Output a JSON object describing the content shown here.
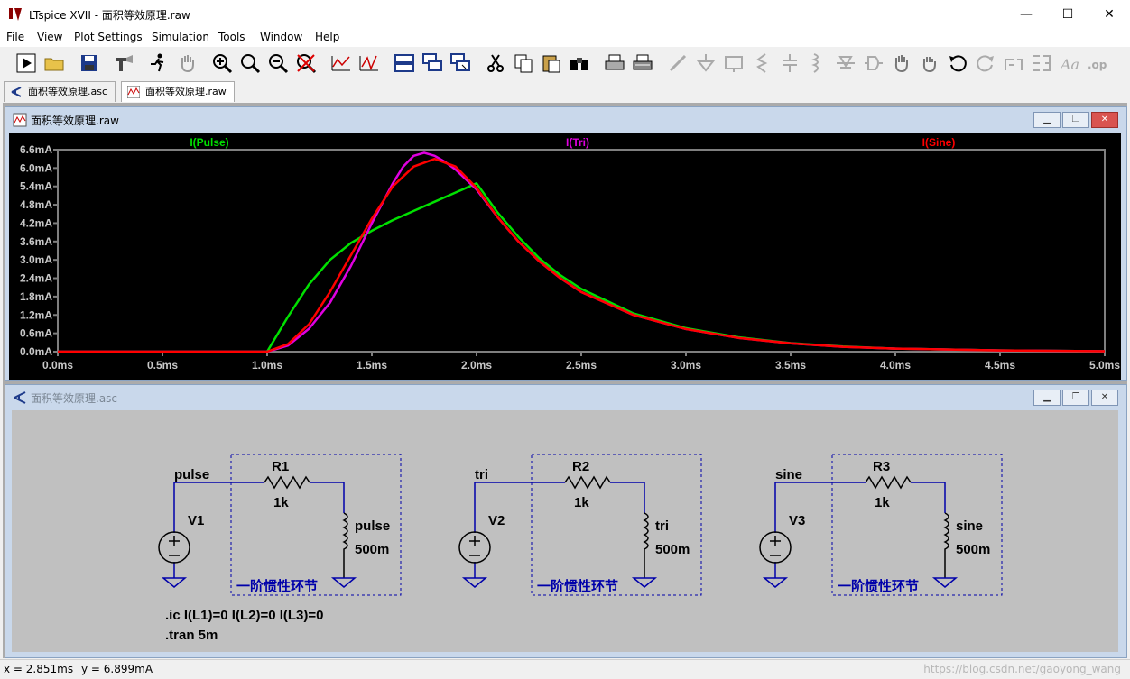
{
  "app": {
    "title": "LTspice XVII - 面积等效原理.raw",
    "controls": {
      "minimize": "—",
      "maximize": "☐",
      "close": "✕"
    }
  },
  "menu": [
    "File",
    "View",
    "Plot Settings",
    "Simulation",
    "Tools",
    "Window",
    "Help"
  ],
  "toolbar_icons": [
    "run-icon",
    "open-icon",
    "save-icon",
    "control-panel-icon",
    "halt-icon",
    "pan-hand-icon",
    "zoom-in-icon",
    "zoom-full-icon",
    "zoom-out-icon",
    "zoom-cancel-icon",
    "autorange-icon",
    "mark-unref-icon",
    "tile-horizontal-icon",
    "tile-cascade-icon",
    "tile-close-icon",
    "cut-icon",
    "copy-icon",
    "paste-icon",
    "find-icon",
    "print-icon",
    "print-setup-icon",
    "wire-icon",
    "ground-icon",
    "label-icon",
    "resistor-icon",
    "capacitor-icon",
    "inductor-icon",
    "diode-icon",
    "component-icon",
    "move-icon",
    "drag-icon",
    "undo-icon",
    "redo-icon",
    "rotate-icon",
    "mirror-icon",
    "text-icon",
    "spice-directive-icon"
  ],
  "tabs": [
    {
      "label": "面积等效原理.asc",
      "icon": "schematic-icon",
      "active": false
    },
    {
      "label": "面积等效原理.raw",
      "icon": "waveform-icon",
      "active": true
    }
  ],
  "plot_window": {
    "title": "面积等效原理.raw"
  },
  "schematic_window": {
    "title": "面积等效原理.asc"
  },
  "colors": {
    "pulse": "#00e000",
    "tri": "#e000e0",
    "sine": "#ff0000",
    "wire": "#0000aa",
    "grid": "#7f7f7f"
  },
  "chart_data": {
    "type": "line",
    "title": "",
    "xlabel": "",
    "ylabel": "",
    "x_ticks": [
      "0.0ms",
      "0.5ms",
      "1.0ms",
      "1.5ms",
      "2.0ms",
      "2.5ms",
      "3.0ms",
      "3.5ms",
      "4.0ms",
      "4.5ms",
      "5.0ms"
    ],
    "y_ticks": [
      "0.0mA",
      "0.6mA",
      "1.2mA",
      "1.8mA",
      "2.4mA",
      "3.0mA",
      "3.6mA",
      "4.2mA",
      "4.8mA",
      "5.4mA",
      "6.0mA",
      "6.6mA"
    ],
    "xlim": [
      0,
      5.0
    ],
    "ylim": [
      0,
      6.6
    ],
    "legend_placement": "top",
    "series": [
      {
        "name": "I(Pulse)",
        "color": "#00e000",
        "x": [
          0,
          0.5,
          1.0,
          1.1,
          1.2,
          1.3,
          1.4,
          1.5,
          1.6,
          1.7,
          1.8,
          1.9,
          2.0,
          2.1,
          2.2,
          2.3,
          2.4,
          2.5,
          2.75,
          3.0,
          3.25,
          3.5,
          3.75,
          4.0,
          4.5,
          5.0
        ],
        "y": [
          0,
          0,
          0,
          1.15,
          2.2,
          3.0,
          3.55,
          3.95,
          4.3,
          4.6,
          4.9,
          5.2,
          5.5,
          4.55,
          3.75,
          3.05,
          2.5,
          2.05,
          1.25,
          0.77,
          0.47,
          0.28,
          0.17,
          0.1,
          0.04,
          0.015
        ]
      },
      {
        "name": "I(Tri)",
        "color": "#e000e0",
        "x": [
          0,
          0.5,
          1.0,
          1.1,
          1.2,
          1.3,
          1.4,
          1.5,
          1.6,
          1.65,
          1.7,
          1.75,
          1.8,
          1.85,
          1.9,
          2.0,
          2.1,
          2.2,
          2.3,
          2.4,
          2.5,
          2.75,
          3.0,
          3.25,
          3.5,
          3.75,
          4.0,
          4.5,
          5.0
        ],
        "y": [
          0,
          0,
          0,
          0.2,
          0.75,
          1.6,
          2.8,
          4.2,
          5.5,
          6.05,
          6.4,
          6.5,
          6.4,
          6.2,
          5.95,
          5.3,
          4.4,
          3.6,
          2.95,
          2.4,
          1.95,
          1.2,
          0.74,
          0.45,
          0.27,
          0.16,
          0.1,
          0.04,
          0.015
        ]
      },
      {
        "name": "I(Sine)",
        "color": "#ff0000",
        "x": [
          0,
          0.5,
          1.0,
          1.1,
          1.2,
          1.3,
          1.4,
          1.5,
          1.6,
          1.7,
          1.8,
          1.9,
          2.0,
          2.1,
          2.2,
          2.3,
          2.4,
          2.5,
          2.75,
          3.0,
          3.25,
          3.5,
          3.75,
          4.0,
          4.5,
          5.0
        ],
        "y": [
          0,
          0,
          0,
          0.25,
          0.9,
          1.95,
          3.15,
          4.35,
          5.4,
          6.05,
          6.3,
          6.05,
          5.35,
          4.4,
          3.6,
          2.95,
          2.4,
          1.95,
          1.2,
          0.74,
          0.45,
          0.27,
          0.16,
          0.1,
          0.04,
          0.015
        ]
      }
    ]
  },
  "schematic": {
    "circuits": [
      {
        "net": "pulse",
        "source": "V1",
        "resistor": "R1",
        "r_value": "1k",
        "inductor_net": "pulse",
        "l_value": "500m",
        "box_label": "一阶惯性环节"
      },
      {
        "net": "tri",
        "source": "V2",
        "resistor": "R2",
        "r_value": "1k",
        "inductor_net": "tri",
        "l_value": "500m",
        "box_label": "一阶惯性环节"
      },
      {
        "net": "sine",
        "source": "V3",
        "resistor": "R3",
        "r_value": "1k",
        "inductor_net": "sine",
        "l_value": "500m",
        "box_label": "一阶惯性环节"
      }
    ],
    "directives": [
      ".ic I(L1)=0 I(L2)=0 I(L3)=0",
      ".tran 5m"
    ]
  },
  "status": {
    "x": "x = 2.851ms",
    "y": "y = 6.899mA",
    "watermark": "https://blog.csdn.net/gaoyong_wang"
  }
}
